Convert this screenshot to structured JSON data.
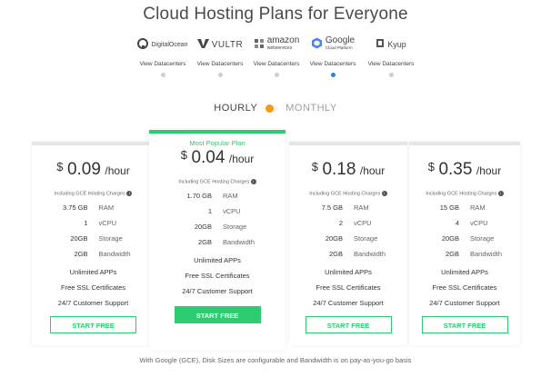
{
  "header": {
    "title": "Cloud Hosting Plans for Everyone"
  },
  "providers": [
    {
      "name": "DigitalOcean",
      "logo_text": "DigitalOcean",
      "icon": "digitalocean-icon",
      "link": "View Datacenters",
      "active": false
    },
    {
      "name": "Vultr",
      "logo_text": "VULTR",
      "icon": "vultr-icon",
      "link": "View Datacenters",
      "active": false
    },
    {
      "name": "Amazon Web Services",
      "logo_text": "amazon",
      "logo_sub": "webservices",
      "icon": "amazon-icon",
      "link": "View Datacenters",
      "active": false
    },
    {
      "name": "Google Cloud Platform",
      "logo_text": "Google",
      "logo_sub": "Cloud Platform",
      "icon": "google-cloud-icon",
      "link": "View Datacenters",
      "active": true
    },
    {
      "name": "Kyup",
      "logo_text": "Kyup",
      "icon": "kyup-icon",
      "link": "View Datacenters",
      "active": false
    }
  ],
  "billing_toggle": {
    "left": "HOURLY",
    "right": "MONTHLY",
    "selected": "HOURLY",
    "knob_color": "#f39c12"
  },
  "plans": [
    {
      "badge": "",
      "currency": "$",
      "price": "0.09",
      "unit": "/hour",
      "charges_note": "Including GCE Hosting Charges",
      "specs": [
        {
          "value": "3.75 GB",
          "label": "RAM"
        },
        {
          "value": "1",
          "label": "vCPU"
        },
        {
          "value": "20GB",
          "label": "Storage"
        },
        {
          "value": "2GB",
          "label": "Bandwidth"
        }
      ],
      "features": [
        "Unlimited APPs",
        "Free SSL Certificates",
        "24/7 Customer Support"
      ],
      "button": "START FREE",
      "featured": false
    },
    {
      "badge": "Most Popular Plan",
      "currency": "$",
      "price": "0.04",
      "unit": "/hour",
      "charges_note": "Including GCE Hosting Charges",
      "specs": [
        {
          "value": "1.70 GB",
          "label": "RAM"
        },
        {
          "value": "1",
          "label": "vCPU"
        },
        {
          "value": "20GB",
          "label": "Storage"
        },
        {
          "value": "2GB",
          "label": "Bandwidth"
        }
      ],
      "features": [
        "Unlimited APPs",
        "Free SSL Certificates",
        "24/7 Customer Support"
      ],
      "button": "START FREE",
      "featured": true
    },
    {
      "badge": "",
      "currency": "$",
      "price": "0.18",
      "unit": "/hour",
      "charges_note": "Including GCE Hosting Charges",
      "specs": [
        {
          "value": "7.5 GB",
          "label": "RAM"
        },
        {
          "value": "2",
          "label": "vCPU"
        },
        {
          "value": "20GB",
          "label": "Storage"
        },
        {
          "value": "2GB",
          "label": "Bandwidth"
        }
      ],
      "features": [
        "Unlimited APPs",
        "Free SSL Certificates",
        "24/7 Customer Support"
      ],
      "button": "START FREE",
      "featured": false
    },
    {
      "badge": "",
      "currency": "$",
      "price": "0.35",
      "unit": "/hour",
      "charges_note": "Including GCE Hosting Charges",
      "specs": [
        {
          "value": "15 GB",
          "label": "RAM"
        },
        {
          "value": "4",
          "label": "vCPU"
        },
        {
          "value": "20GB",
          "label": "Storage"
        },
        {
          "value": "2GB",
          "label": "Bandwidth"
        }
      ],
      "features": [
        "Unlimited APPs",
        "Free SSL Certificates",
        "24/7 Customer Support"
      ],
      "button": "START FREE",
      "featured": false
    }
  ],
  "colors": {
    "accent": "#2ecc71",
    "active_dot": "#2e82c9",
    "inactive_dot": "#c8d0d6"
  },
  "footer": {
    "note": "With Google (GCE), Disk Sizes are configurable and Bandwidth is on pay-as-you-go basis"
  }
}
